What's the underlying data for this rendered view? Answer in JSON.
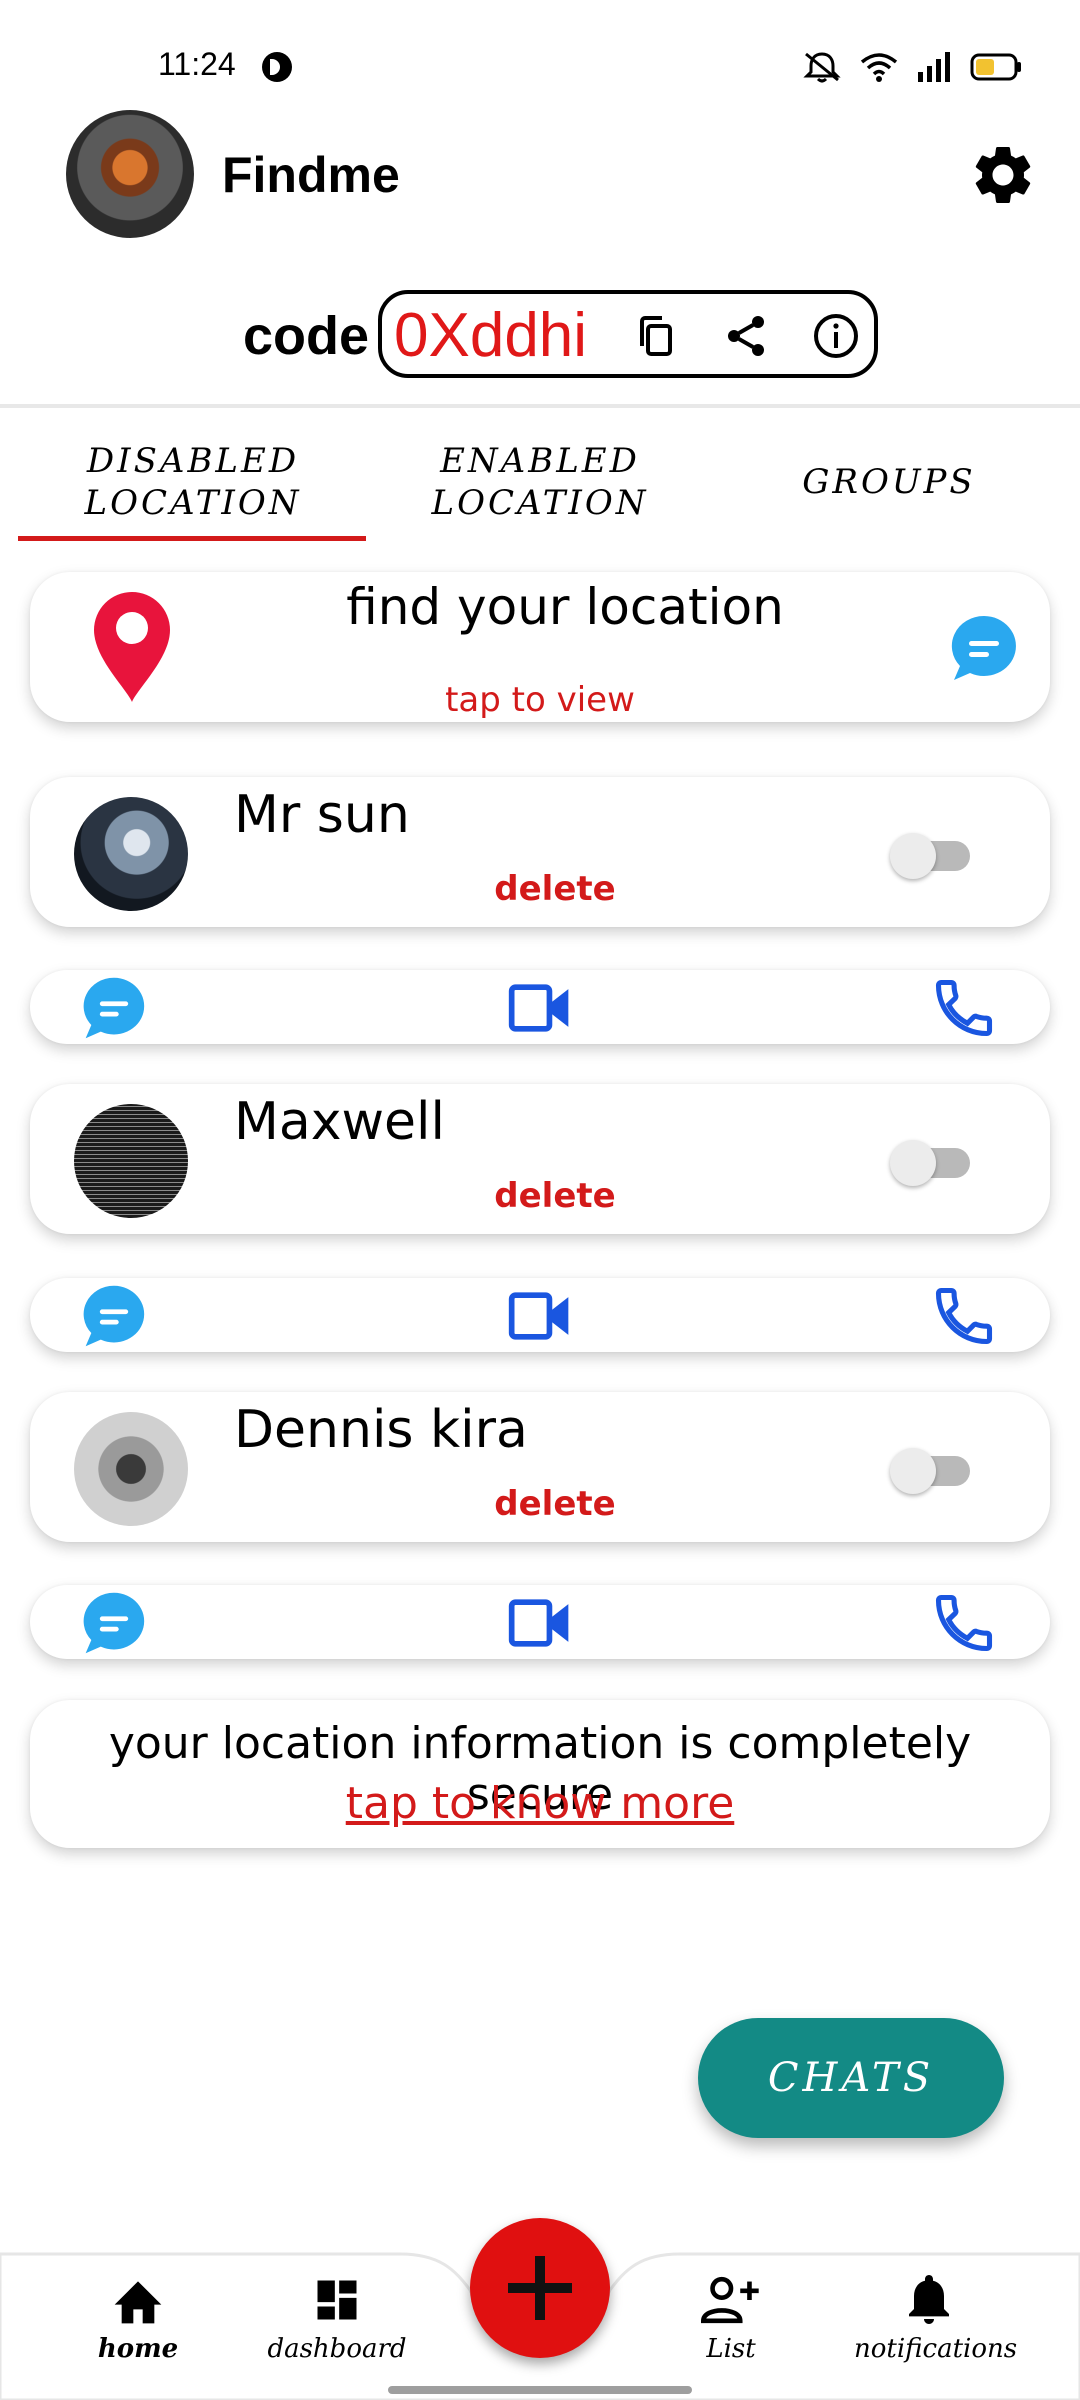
{
  "status_bar": {
    "time": "11:24",
    "icons": [
      "dnd-indicator-icon",
      "mute-icon",
      "wifi-icon",
      "signal-icon",
      "battery-icon"
    ]
  },
  "header": {
    "app_title": "Findme",
    "settings_icon": "gear-icon"
  },
  "code": {
    "label": "code",
    "value": "0Xddhi",
    "icons": [
      "copy-icon",
      "share-icon",
      "info-icon"
    ]
  },
  "tabs": [
    {
      "line1": "DISABLED",
      "line2": "LOCATION",
      "active": true
    },
    {
      "line1": "ENABLED",
      "line2": "LOCATION",
      "active": false
    },
    {
      "line1": "GROUPS",
      "line2": "",
      "active": false
    }
  ],
  "find_card": {
    "title": "find your location",
    "subtitle": "tap to view"
  },
  "contacts": [
    {
      "name": "Mr sun",
      "delete_label": "delete",
      "location_enabled": false
    },
    {
      "name": "Maxwell",
      "delete_label": "delete",
      "location_enabled": false
    },
    {
      "name": "Dennis kira",
      "delete_label": "delete",
      "location_enabled": false
    }
  ],
  "secure_card": {
    "text": "your location information is completely secure",
    "link": "tap to know more"
  },
  "chats_button": "CHATS",
  "bottom_nav": [
    {
      "label": "home",
      "icon": "home-icon"
    },
    {
      "label": "dashboard",
      "icon": "dashboard-icon"
    },
    {
      "label": "List",
      "icon": "add-person-icon"
    },
    {
      "label": "notifications",
      "icon": "bell-icon"
    }
  ],
  "colors": {
    "accent_red": "#d31a1a",
    "code_red": "#e01818",
    "action_blue": "#1a56e0",
    "chat_blue": "#2aa8ef",
    "teal": "#138a85",
    "fab_red": "#e01010"
  }
}
